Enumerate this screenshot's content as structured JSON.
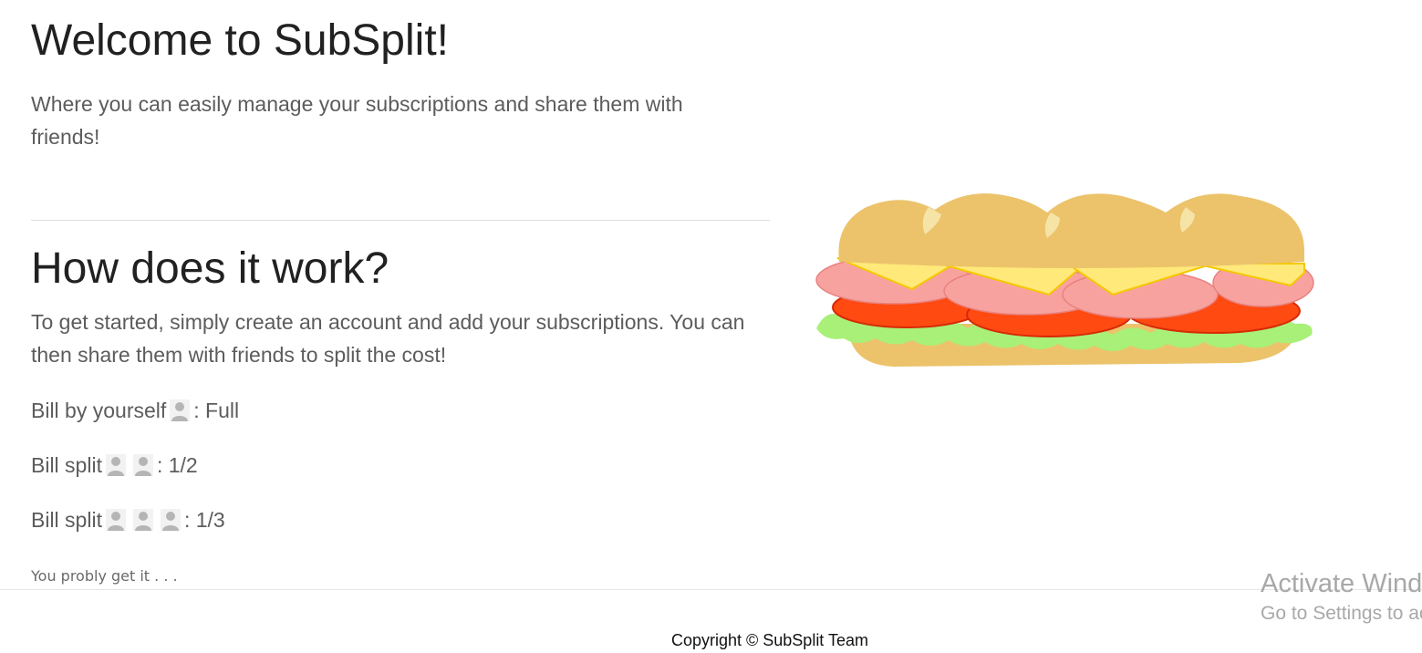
{
  "hero": {
    "title": "Welcome to SubSplit!",
    "tagline": "Where you can easily manage your subscriptions and share them with friends!"
  },
  "how": {
    "heading": "How does it work?",
    "intro": "To get started, simply create an account and add your subscriptions. You can then share them with friends to split the cost!",
    "rows": [
      {
        "label": "Bill by yourself",
        "people": 1,
        "value": ": Full"
      },
      {
        "label": "Bill split",
        "people": 2,
        "value": ": 1/2"
      },
      {
        "label": "Bill split",
        "people": 3,
        "value": ": 1/3"
      }
    ],
    "outro": "You probly get it . . ."
  },
  "illustration": {
    "icon": "sandwich-illustration"
  },
  "footer": {
    "copyright": "Copyright © SubSplit Team"
  },
  "watermark": {
    "line1": "Activate Windows",
    "line2": "Go to Settings to activate Windows."
  },
  "colors": {
    "heading": "#212121",
    "body_text": "#5c5c5c",
    "person_icon": "#b5b5b5",
    "bread": "#ecc36b",
    "cheese": "#ffe97a",
    "ham": "#f8a2a0",
    "tomato": "#ff4a12",
    "lettuce": "#a8f078"
  }
}
